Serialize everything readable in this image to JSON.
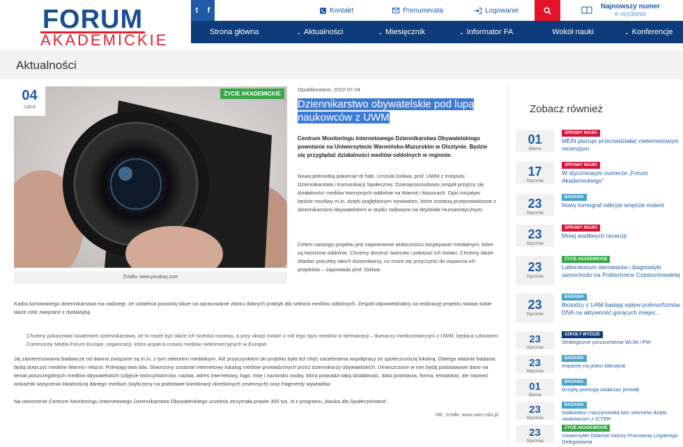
{
  "logo": {
    "line1": "FORUM",
    "line2": "AKADEMICKIE"
  },
  "topbar": {
    "social": {
      "twitter": "t",
      "facebook": "f"
    },
    "links": [
      {
        "label": "Kontakt",
        "icon": "phone-icon"
      },
      {
        "label": "Prenumerata",
        "icon": "mail-icon"
      },
      {
        "label": "Logowanie",
        "icon": "login-icon"
      }
    ],
    "issue_line1": "Najnowszy numer",
    "issue_line2": "e-wydanie"
  },
  "nav": [
    "Strona główna",
    "Aktualności",
    "Miesięcznik",
    "Informator FA",
    "Wokół nauki",
    "Konferencje"
  ],
  "page_title": "Aktualności",
  "article": {
    "day": "04",
    "month": "Lipca",
    "category": "ŻYCIE AKADEMICKIE",
    "caption": "Źródło: www.pixabay.com",
    "published": "Opublikowano: 2022-07-04",
    "title": "Dziennikarstwo obywatelskie pod lupą naukowców z UWM",
    "lead": "Centrum Monitoringu Internetowego Dziennikarstwa Obywatelskiego powstanie na Uniwersytecie Warmińsko-Mazurskim w Olsztynie. Będzie się przyglądać działalności mediów oddolnych w regionie.",
    "p1": "Nową jednostką pokieruje dr hab. Urszula Doliwa, prof. UWM z Instytutu Dziennikarstwa i Komunikacji Społecznej. Dziesięcioosobowy zespół przyjrzy się działalności mediów tworzonych oddolnie na Warmii i Mazurach. Opis inicjatyw będzie możliwy m.in. dzięki pogłębionym wywiadom, które zostaną przeprowadzone z dziennikarzami obywatelskimi w studiu radiowym na Wydziale Humanistycznym.",
    "p2": "Celem naszego projektu jest zapewnienie widoczności inicjatywom medialnym, które są tworzone oddolnie. Chcemy docenić twórców i pokazać ich światu. Chcemy także zbadać potrzeby takich dziennikarzy, co może się przyczynić do wsparcia ich projektów – zapowiada prof. Doliwa.",
    "p3": "Kadra kortowskiego dziennikarstwa ma nadzieję, że ustalenia pozwolą także na opracowanie zbioru dobrych praktyk dla sektora mediów oddolnych. Zespół odpowiedzialny za realizację projektu stawia sobie także cele związane z dydaktyką.",
    "quote": "Chcemy pokazywać studentom dziennikarstwa, że to może być także ich ścieżka rozwoju, a przy okazji mówić o roli tego typu mediów w demokracji – tłumaczy medioznawczyni z UWM, będąca członkiem Community Media Forum Europe, organizacji, która wspiera rozwój mediów niekomercyjnych w Europie.",
    "p4": "Jej zainteresowania badawcze od dawna związane są m.in. z tym sektorem medialnym. Ale przyczynkiem do projektu była też chęć zacieśnienia współpracy ze społecznością lokalną. Dlatego właśnie badania będą dotyczyć mediów Warmii i Mazur. Potrwają dwa lata. Stworzony zostanie internetowy katalog mediów prowadzonych przez dziennikarzy obywatelskich. Umieszczone w nim będą podstawowe dane na temat poszczególnych mediów obywatelskich (zdjęcie twórcy/twórców, nazwa, adres internetowy, logo, imię i nazwisko osoby, która prowadzi taką działalność, data powstania, forma, tematyka), ale również wskaźnik wysycenia lokalnością danego medium (wyliczony na podstawie kombinacji określonych zmiennych) oraz fragmenty wywiadów.",
    "p5": "Na utworzenie Centrum Monitoringu Internetowego Dziennikarstwa Obywatelskiego uczelnia otrzymała prawie 300 tys. zł z programu „Nauka dla Społeczeństwa”.",
    "source": "MK, źródło: www.uwm.edu.pl"
  },
  "sidebar": {
    "heading": "Zobacz również",
    "items": [
      {
        "day": "01",
        "month": "Marca",
        "tag": "SPRAWY NAUKI",
        "tag_color": "#d6133b",
        "title": "MEiN planuje przeciwdziałać nieterminowym recenzjom"
      },
      {
        "day": "17",
        "month": "Stycznia",
        "tag": "SPRAWY NAUKI",
        "tag_color": "#d6133b",
        "title": "W styczniowym numerze „Forum Akademickiego”"
      },
      {
        "day": "23",
        "month": "Stycznia",
        "tag": "BADANIA",
        "tag_color": "#4aa3c8",
        "title": "Nowy tomograf odkryje wnętrze materii"
      },
      {
        "day": "23",
        "month": "Stycznia",
        "tag": "SPRAWY NAUKI",
        "tag_color": "#d6133b",
        "title": "Mniej wadliwych recenzji"
      },
      {
        "day": "23",
        "month": "Stycznia",
        "tag": "ŻYCIE AKADEMICKIE",
        "tag_color": "#33a845",
        "title": "Laboratorium sterowania i diagnostyki samochodu na Politechnice Częstochowskiej"
      },
      {
        "day": "23",
        "month": "Stycznia",
        "tag": "BADANIA",
        "tag_color": "#4aa3c8",
        "title": "Biolodzy z UAM badają wpływ polimorfizmów DNA na aktywność gorących miejsc..."
      },
      {
        "day": "23",
        "month": "Stycznia",
        "tag": "SZKOŁY WYŻSZE",
        "tag_color": "#0d3b7b",
        "title": "Strategiczne porozumienie WUM i PW"
      },
      {
        "day": "23",
        "month": "Stycznia",
        "tag": "BADANIA",
        "tag_color": "#4aa3c8",
        "title": "Implanty na jedno kliknięcie"
      },
      {
        "day": "01",
        "month": "Marca",
        "tag": "BADANIA",
        "tag_color": "#4aa3c8",
        "title": "Grzyby pomogą zwalczać jemiołę"
      },
      {
        "day": "23",
        "month": "Stycznia",
        "tag": "BADANIA",
        "tag_color": "#4aa3c8",
        "title": "Siatkówka i naczyniówka bez sekretów dzięki naukowcom z ICTER"
      },
      {
        "day": "23",
        "month": "Stycznia",
        "tag": "ŻYCIE AKADEMICKIE",
        "tag_color": "#33a845",
        "title": "Uniwersytet Gdański tworzy Pracownię Legalnego Delegowania"
      }
    ]
  }
}
